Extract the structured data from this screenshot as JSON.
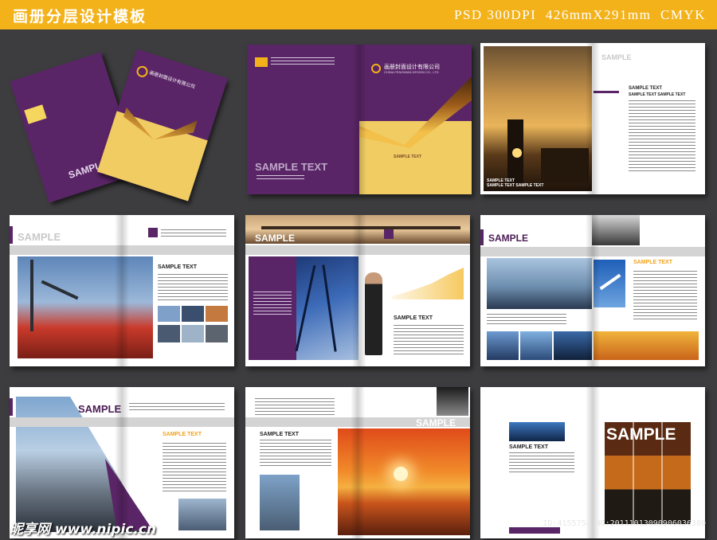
{
  "header": {
    "title": "画册分层设计模板",
    "spec": "PSD 300DPI  426mmX291mm  CMYK"
  },
  "cover": {
    "company_cn": "画册封面设计有限公司",
    "company_en": "CHINA FENGMIAN DESIGN CO., LTD",
    "big_text": "SAMPLE TEXT",
    "small_text": "SAMPLE TEXT",
    "sample": "SAMPLE"
  },
  "spread1": {
    "title": "SAMPLE",
    "heading": "SAMPLE TEXT",
    "sub": "SAMPLE TEXT SAMPLE TEXT",
    "caption": "SAMPLE TEXT",
    "caption2": "SAMPLE TEXT SAMPLE TEXT"
  },
  "spread2": {
    "title": "SAMPLE",
    "heading": "SAMPLE TEXT"
  },
  "spread3": {
    "title": "SAMPLE",
    "heading": "SAMPLE TEXT"
  },
  "spread4": {
    "title": "SAMPLE",
    "heading": "SAMPLE TEXT"
  },
  "spread5": {
    "title": "SAMPLE",
    "heading": "SAMPLE TEXT"
  },
  "spread6": {
    "title": "SAMPLE",
    "heading": "SAMPLE TEXT"
  },
  "spread7": {
    "title": "SAMPLE",
    "heading": "SAMPLE TEXT"
  },
  "watermark": {
    "site": "昵享网 www.nipic.cn",
    "id": "ID:4155754 NO:20111013090906036380"
  },
  "colors": {
    "purple": "#5a2566",
    "yellow": "#f3b21a",
    "background": "#3d3d3f"
  }
}
